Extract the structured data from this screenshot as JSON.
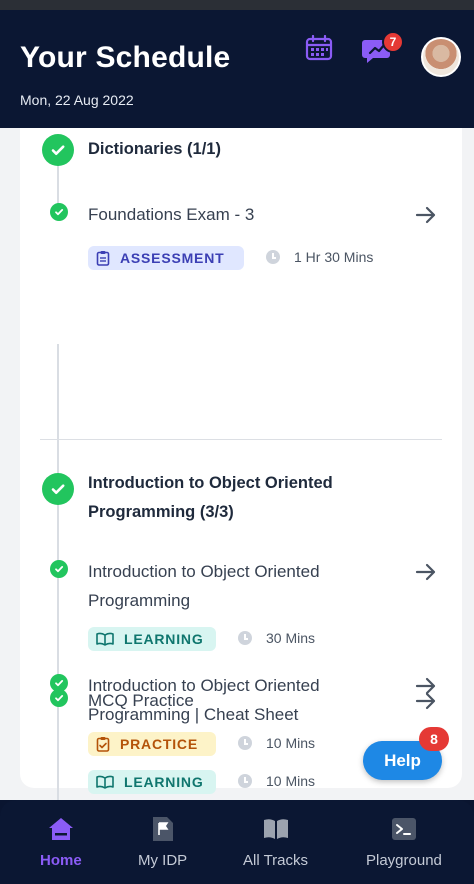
{
  "header": {
    "title": "Your Schedule",
    "date": "Mon, 22 Aug 2022",
    "notification_count": "7",
    "accent_color": "#8b5cf6"
  },
  "schedule": {
    "sections": [
      {
        "title": "Dictionaries (1/1)",
        "completed": true,
        "items": [
          {
            "title": "Foundations Exam - 3",
            "tag": "ASSESSMENT",
            "tag_icon": "clipboard-icon",
            "duration": "1 Hr 30 Mins",
            "completed": true
          }
        ]
      },
      {
        "title": "Introduction to Object Oriented Programming (3/3)",
        "completed": true,
        "items": [
          {
            "title": "Introduction to Object Oriented Programming",
            "tag": "LEARNING",
            "tag_icon": "book-icon",
            "duration": "30 Mins",
            "completed": true
          },
          {
            "title": "Introduction to Object Oriented Programming | Cheat Sheet",
            "tag": "LEARNING",
            "tag_icon": "book-icon",
            "duration": "10 Mins",
            "completed": true
          },
          {
            "title": "MCQ Practice",
            "tag": "PRACTICE",
            "tag_icon": "clipboard-check-icon",
            "duration": "10 Mins",
            "completed": true
          }
        ]
      }
    ]
  },
  "help": {
    "label": "Help",
    "count": "8"
  },
  "nav": {
    "items": [
      {
        "label": "Home",
        "icon": "home-icon",
        "active": true
      },
      {
        "label": "My IDP",
        "icon": "flag-document-icon",
        "active": false
      },
      {
        "label": "All Tracks",
        "icon": "open-book-icon",
        "active": false
      },
      {
        "label": "Playground",
        "icon": "terminal-icon",
        "active": false
      }
    ]
  },
  "colors": {
    "header_bg": "#0b1733",
    "success": "#22c55e",
    "help_button": "#1e88e5",
    "badge": "#e53935"
  }
}
